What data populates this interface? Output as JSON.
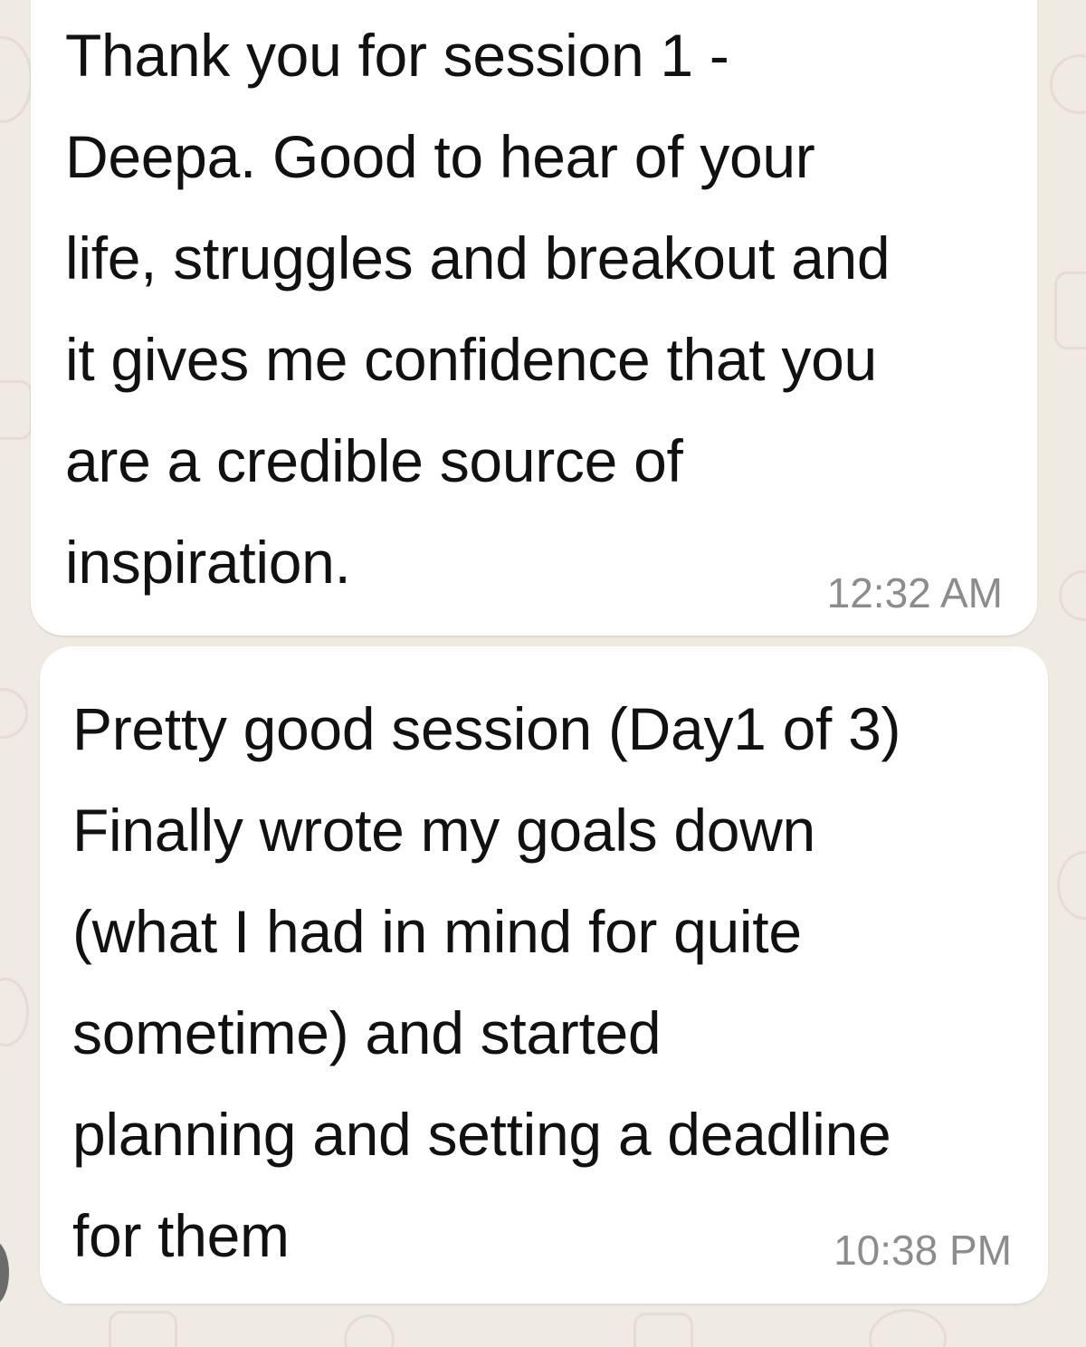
{
  "chat": {
    "messages": [
      {
        "text": "Thank you for session 1 -\nDeepa. Good to hear of your\nlife, struggles and breakout and\nit gives me confidence that you\nare a credible source of\ninspiration.",
        "time": "12:32 AM"
      },
      {
        "text": "Pretty good session (Day1 of 3)\nFinally wrote my goals down\n(what I had in mind for quite\nsometime) and started\nplanning and setting a deadline\nfor them",
        "time": "10:38 PM"
      }
    ]
  },
  "colors": {
    "wallpaper": "#EFEAE2",
    "bubble": "#FFFFFF",
    "text": "#111111",
    "timestamp": "#8C8C8C"
  }
}
